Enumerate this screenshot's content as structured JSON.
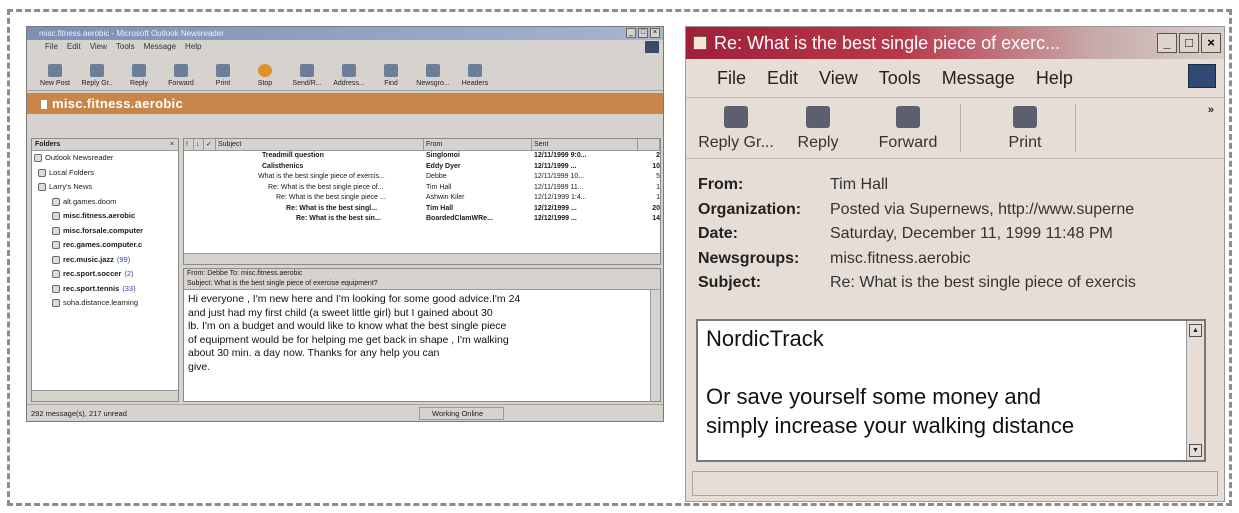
{
  "left": {
    "title": "misc.fitness.aerobic - Microsoft Outlook Newsreader",
    "menu": [
      "File",
      "Edit",
      "View",
      "Tools",
      "Message",
      "Help"
    ],
    "toolbar": [
      "New Post",
      "Reply Gr..",
      "Reply",
      "Forward",
      "Print",
      "Stop",
      "Send/R...",
      "Address...",
      "Find",
      "Newsgro...",
      "Headers"
    ],
    "folder_bar": "misc.fitness.aerobic",
    "folders_header": "Folders",
    "folders": [
      {
        "label": "Outlook Newsreader",
        "count": ""
      },
      {
        "label": "Local Folders",
        "count": ""
      },
      {
        "label": "Larry's News",
        "count": ""
      },
      {
        "label": "alt.games.doom",
        "count": ""
      },
      {
        "label": "misc.fitness.aerobic",
        "count": ""
      },
      {
        "label": "misc.forsale.computer",
        "count": ""
      },
      {
        "label": "rec.games.computer.c",
        "count": ""
      },
      {
        "label": "rec.music.jazz",
        "count": "(99)"
      },
      {
        "label": "rec.sport.soccer",
        "count": "(2)"
      },
      {
        "label": "rec.sport.tennis",
        "count": "(33)"
      },
      {
        "label": "soha.distance.learning",
        "count": ""
      }
    ],
    "columns": [
      "Subject",
      "From",
      "Sent"
    ],
    "messages": [
      {
        "subject": "Treadmill question",
        "from": "Singlomoi",
        "sent": "12/11/1999 9:0...",
        "size": "2"
      },
      {
        "subject": "Calisthenics",
        "from": "Eddy Dyer",
        "sent": "12/11/1999 ...",
        "size": "10"
      },
      {
        "subject": "What is the best single piece of exercis...",
        "from": "Debbe",
        "sent": "12/11/1999 10...",
        "size": "5"
      },
      {
        "subject": "Re: What is the best single piece of...",
        "from": "Tim Hall",
        "sent": "12/11/1999 11...",
        "size": "1"
      },
      {
        "subject": "Re: What is the best single piece ...",
        "from": "Ashwin Kiler",
        "sent": "12/12/1999 1:4...",
        "size": "1"
      },
      {
        "subject": "Re: What is the best singl...",
        "from": "Tim Hall",
        "sent": "12/12/1999 ...",
        "size": "20"
      },
      {
        "subject": "Re: What is the best sin...",
        "from": "BoardedClamWRe...",
        "sent": "12/12/1999 ...",
        "size": "14"
      }
    ],
    "preview": {
      "from_line": "From: Debbe   To: misc.fitness.aerobic",
      "subject_line": "Subject: What is the best single piece of exercise equipment?",
      "body": "Hi everyone , I'm new here and I'm looking for some good advice.I'm 24\nand just had my first child (a sweet little girl) but I gained about 30\nlb. I'm on a budget and would like to know what the best single piece\nof equipment would be for helping me get back in shape , I'm walking\nabout 30 min. a day now. Thanks for any help you can\ngive."
    },
    "status_count": "292 message(s), 217 unread",
    "status_online": "Working Online"
  },
  "right": {
    "title": "Re: What is the best single piece of exerc...",
    "window_controls": [
      "_",
      "□",
      "×"
    ],
    "menu": [
      "File",
      "Edit",
      "View",
      "Tools",
      "Message",
      "Help"
    ],
    "toolbar": [
      "Reply Gr...",
      "Reply",
      "Forward",
      "Print"
    ],
    "toolbar_more": "»",
    "headers": [
      {
        "label": "From:",
        "value": "Tim Hall"
      },
      {
        "label": "Organization:",
        "value": "Posted via Supernews, http://www.superne"
      },
      {
        "label": "Date:",
        "value": "Saturday, December 11, 1999 11:48 PM"
      },
      {
        "label": "Newsgroups:",
        "value": "misc.fitness.aerobic"
      },
      {
        "label": "Subject:",
        "value": "Re: What is the best single piece of exercis"
      }
    ],
    "body": "NordicTrack\n\nOr save yourself some money and\nsimply increase your walking distance"
  }
}
